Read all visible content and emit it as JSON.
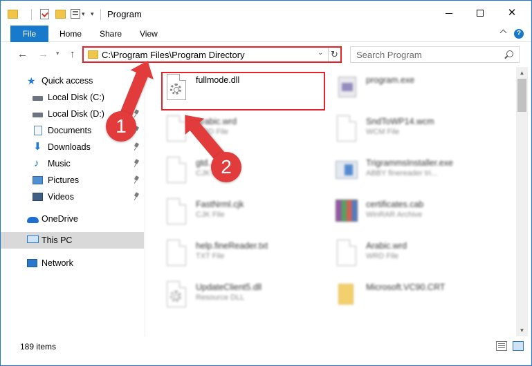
{
  "window": {
    "title": "Program"
  },
  "ribbon": {
    "file": "File",
    "home": "Home",
    "share": "Share",
    "view": "View"
  },
  "nav": {
    "back": "←",
    "forward": "→",
    "recent": "⌄",
    "up": "↑"
  },
  "address": {
    "path": "C:\\Program Files\\Program Directory"
  },
  "search": {
    "placeholder": "Search Program"
  },
  "sidebar": {
    "items": [
      {
        "label": "Quick access",
        "icon": "star-icon"
      },
      {
        "label": "Local Disk (C:)",
        "icon": "disk-icon",
        "pinned": true
      },
      {
        "label": "Local Disk (D:)",
        "icon": "disk-icon",
        "pinned": true
      },
      {
        "label": "Documents",
        "icon": "documents-icon",
        "pinned": true
      },
      {
        "label": "Downloads",
        "icon": "download-icon",
        "pinned": true
      },
      {
        "label": "Music",
        "icon": "music-icon",
        "pinned": true
      },
      {
        "label": "Pictures",
        "icon": "pictures-icon",
        "pinned": true
      },
      {
        "label": "Videos",
        "icon": "videos-icon",
        "pinned": true
      },
      {
        "label": "OneDrive",
        "icon": "cloud-icon"
      },
      {
        "label": "This PC",
        "icon": "computer-icon",
        "selected": true
      },
      {
        "label": "Network",
        "icon": "network-icon"
      }
    ]
  },
  "files": [
    {
      "name": "fullmode.dll",
      "type": "",
      "icon": "dll-gear-icon",
      "highlighted": true
    },
    {
      "name": "program.exe",
      "type": "",
      "icon": "exe-icon"
    },
    {
      "name": "Arabic.wrd",
      "type": "WRD File",
      "icon": "file-icon"
    },
    {
      "name": "SndToWP14.wcm",
      "type": "WCM File",
      "icon": "file-icon"
    },
    {
      "name": "gtd...",
      "type": "CJK File",
      "icon": "file-icon"
    },
    {
      "name": "TrigrammsInstaller.exe",
      "type": "ABBY finereader tri...",
      "icon": "installer-icon"
    },
    {
      "name": "FastNrml.cjk",
      "type": "CJK File",
      "icon": "file-icon"
    },
    {
      "name": "certificates.cab",
      "type": "WinRAR Archive",
      "icon": "winrar-icon"
    },
    {
      "name": "help.fineReader.txt",
      "type": "TXT File",
      "icon": "file-icon"
    },
    {
      "name": "Arabic.wrd",
      "type": "WRD File",
      "icon": "file-icon"
    },
    {
      "name": "UpdateClient5.dll",
      "type": "Resource DLL",
      "icon": "dll-gear-icon"
    },
    {
      "name": "Microsoft.VC90.CRT",
      "type": "",
      "icon": "folder-icon"
    }
  ],
  "annotations": {
    "step1": "1",
    "step2": "2"
  },
  "status": {
    "item_count": "189 items"
  },
  "colors": {
    "accent": "#1979ca",
    "highlight": "#e8202a",
    "annotation": "#e23b3b"
  }
}
